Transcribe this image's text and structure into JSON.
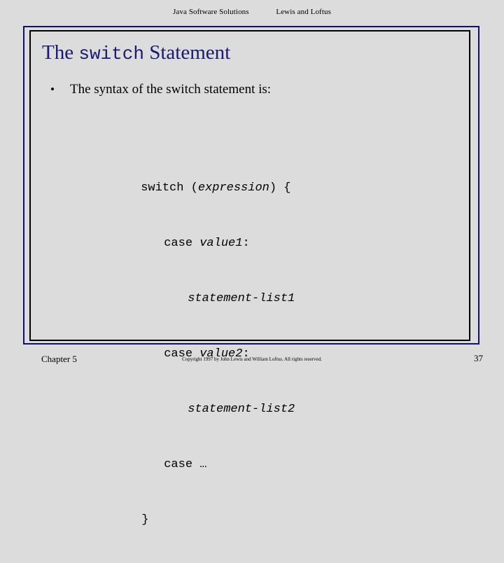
{
  "header": {
    "left_text": "Java Software Solutions",
    "right_text": "Lewis and Loftus"
  },
  "slide": {
    "title_part1": "The ",
    "title_keyword": "switch",
    "title_part2": " Statement",
    "bullet_mark": "•",
    "bullet_text": "The syntax of the switch statement is:",
    "code_lines": [
      {
        "indent": "",
        "plain1": "switch (",
        "italic": "expression",
        "plain2": ") {"
      },
      {
        "indent": "",
        "plain1": "case ",
        "italic": "value1",
        "plain2": ":"
      },
      {
        "indent": "",
        "plain1": "",
        "italic": "statement-list1",
        "plain2": ""
      },
      {
        "indent": "",
        "plain1": "case ",
        "italic": "value2",
        "plain2": ":"
      },
      {
        "indent": "",
        "plain1": "",
        "italic": "statement-list2",
        "plain2": ""
      },
      {
        "indent": "",
        "plain1": "case …",
        "italic": "",
        "plain2": ""
      },
      {
        "indent": "",
        "plain1": "}",
        "italic": "",
        "plain2": ""
      }
    ]
  },
  "footer": {
    "chapter": "Chapter 5",
    "copyright": "Copyright 1997 by John Lewis and William Loftus.  All rights reserved.",
    "page_number": "37"
  },
  "colors": {
    "background": "#dcdcdc",
    "title": "#191970",
    "outer_frame": "#101070",
    "inner_frame": "#000000",
    "text": "#000000"
  }
}
